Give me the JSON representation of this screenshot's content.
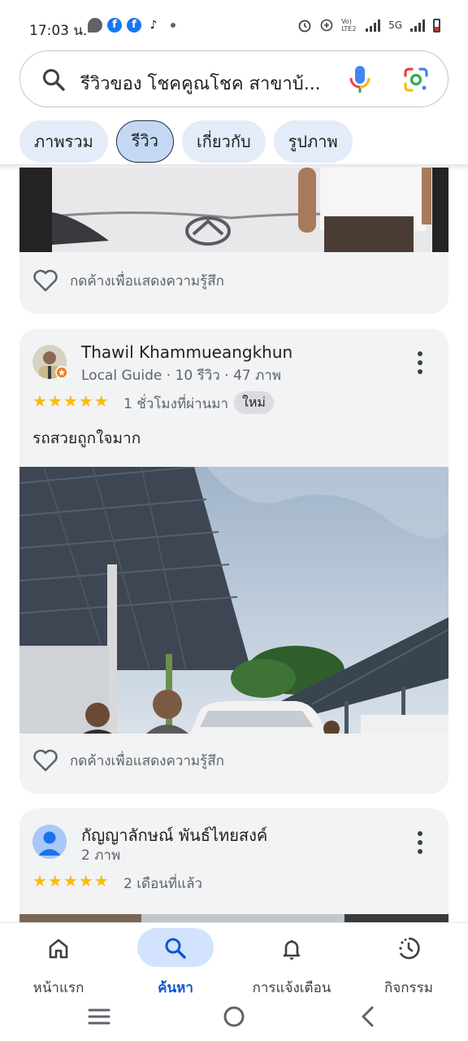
{
  "status_bar": {
    "time": "17:03 น.",
    "network": "5G",
    "volte": "Vo) LTE2"
  },
  "search": {
    "query": "รีวิวของ โชคคูณโชค สาขาบ้..."
  },
  "tabs": [
    {
      "label": "ภาพรวม",
      "active": false
    },
    {
      "label": "รีวิว",
      "active": true
    },
    {
      "label": "เกี่ยวกับ",
      "active": false
    },
    {
      "label": "รูปภาพ",
      "active": false
    }
  ],
  "reviews": [
    {
      "react_label": "กดค้างเพื่อแสดงความรู้สึก"
    },
    {
      "name": "Thawil Khammueangkhun",
      "meta": "Local Guide · 10 รีวิว · 47 ภาพ",
      "rating": 5,
      "stars": "★★★★★",
      "time": "1 ชั่วโมงที่ผ่านมา",
      "badge": "ใหม่",
      "text": "รถสวยถูกใจมาก",
      "react_label": "กดค้างเพื่อแสดงความรู้สึก"
    },
    {
      "name": "กัญญาลักษณ์ พันธ์ไทยสงค์",
      "meta": "2 ภาพ",
      "rating": 5,
      "stars": "★★★★★",
      "time": "2 เดือนที่แล้ว"
    }
  ],
  "bottom_nav": [
    {
      "label": "หน้าแรก",
      "icon": "home-icon",
      "active": false
    },
    {
      "label": "ค้นหา",
      "icon": "search-icon",
      "active": true
    },
    {
      "label": "การแจ้งเตือน",
      "icon": "bell-icon",
      "active": false
    },
    {
      "label": "กิจกรรม",
      "icon": "activity-icon",
      "active": false
    }
  ],
  "colors": {
    "accent": "#0b57d0",
    "star": "#fbbc04",
    "card_bg": "#f1f3f4",
    "tab_bg": "#e3ecf8"
  }
}
